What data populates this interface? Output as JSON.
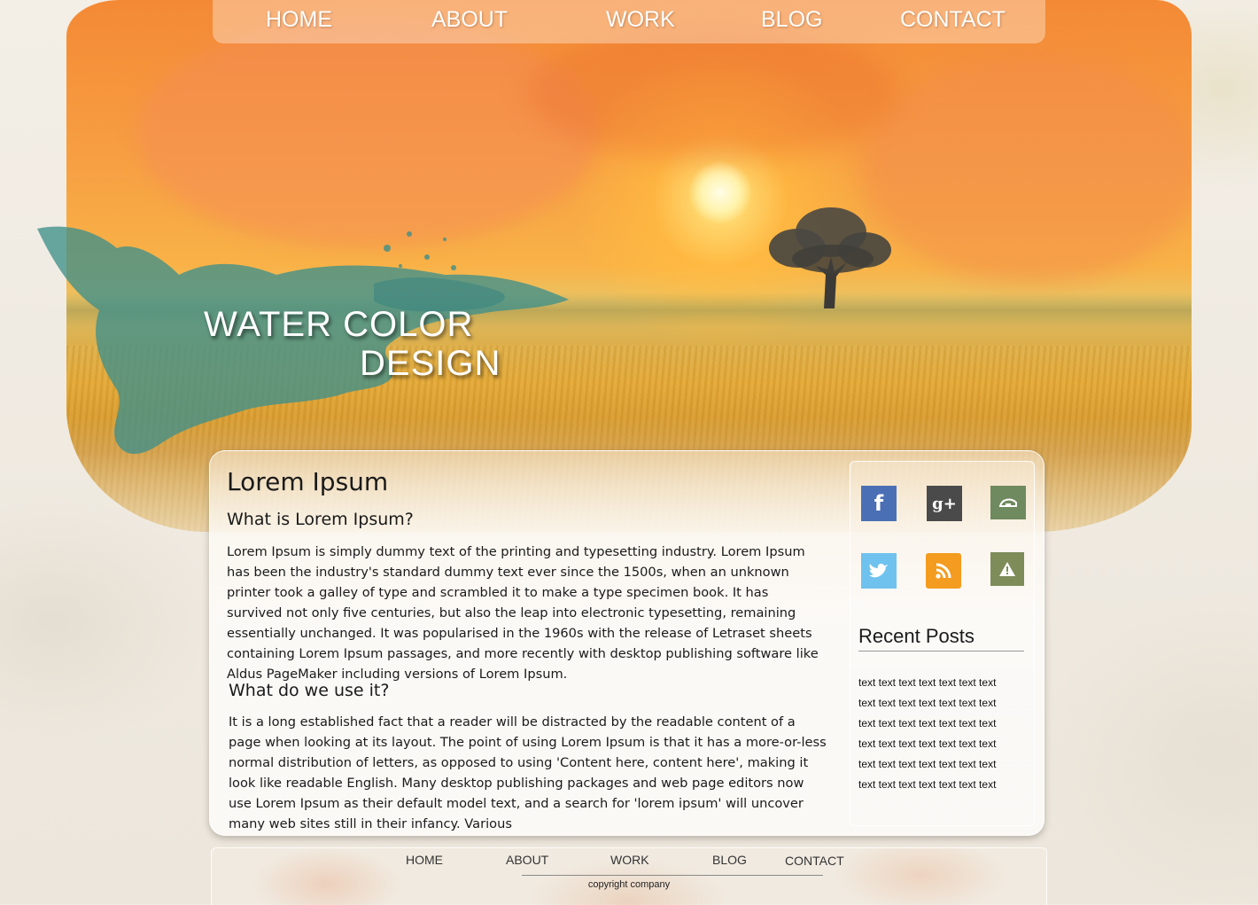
{
  "nav": {
    "items": [
      "HOME",
      "ABOUT",
      "WORK",
      "BLOG",
      "CONTACT"
    ]
  },
  "hero": {
    "title_line1": "WATER COLOR",
    "title_line2": "DESIGN"
  },
  "content": {
    "title": "Lorem Ipsum",
    "section1_heading": "What is Lorem Ipsum?",
    "section1_text": "Lorem Ipsum is simply dummy text of the printing and typesetting industry. Lorem Ipsum has been the industry's standard dummy text ever since the 1500s, when an unknown printer took a galley of type and scrambled it to make a type specimen book. It has survived not only five centuries, but also the leap into electronic typesetting, remaining essentially unchanged. It was popularised in the 1960s with the release of Letraset sheets containing Lorem Ipsum passages, and more recently with desktop publishing software like Aldus PageMaker including versions of Lorem Ipsum.",
    "section2_heading": "What do we use it?",
    "section2_text": "It is a long established fact that a reader will be distracted by the readable content of a page when looking at its layout. The point of using Lorem Ipsum is that it has a more-or-less normal distribution of letters, as opposed to using 'Content here, content here', making it look like readable English. Many desktop publishing packages and web page editors now use Lorem Ipsum as their default model text, and a search for 'lorem ipsum' will uncover many web sites still in their infancy. Various"
  },
  "social": [
    {
      "icon": "facebook-icon",
      "glyph": "f",
      "color": "#4a6fb5"
    },
    {
      "icon": "google-plus-icon",
      "glyph": "g+",
      "color": "#4a4a4a"
    },
    {
      "icon": "delicious-icon",
      "glyph": "",
      "color": "#6f8a5f"
    },
    {
      "icon": "twitter-icon",
      "glyph": "",
      "color": "#6fc2ee"
    },
    {
      "icon": "rss-icon",
      "glyph": "",
      "color": "#f39c1f"
    },
    {
      "icon": "warning-icon",
      "glyph": "",
      "color": "#7e8c5a"
    }
  ],
  "sidebar": {
    "recent_title": "Recent Posts",
    "posts": [
      "text text text text text text text",
      "text text text text text text text",
      "text text text text text text text",
      "text text text text text text text",
      "text text text text text text text",
      "text text text text text text text"
    ]
  },
  "footer": {
    "nav": [
      "HOME",
      "ABOUT",
      "WORK",
      "BLOG",
      "CONTACT"
    ],
    "copyright": "copyright company"
  }
}
